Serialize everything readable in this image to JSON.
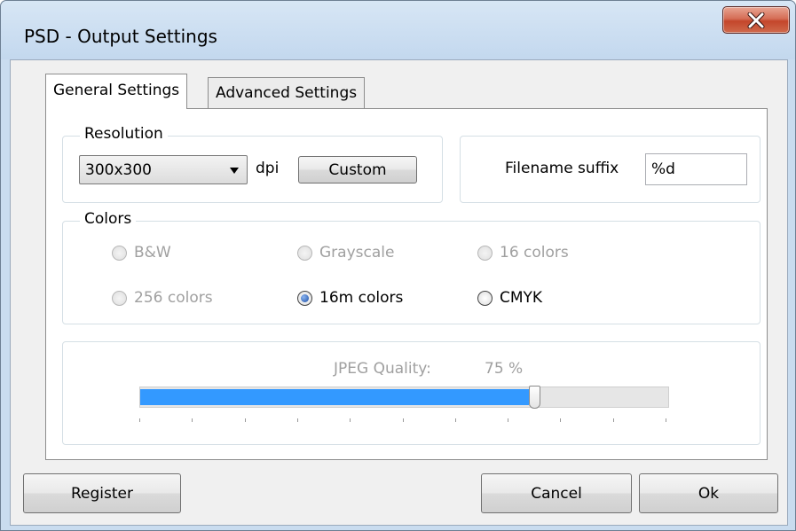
{
  "window": {
    "title": "PSD - Output Settings"
  },
  "tabs": [
    {
      "label": "General Settings",
      "active": true
    },
    {
      "label": "Advanced Settings",
      "active": false
    }
  ],
  "resolution": {
    "group_label": "Resolution",
    "selected": "300x300",
    "unit": "dpi",
    "custom_label": "Custom"
  },
  "filename": {
    "label": "Filename suffix",
    "value": "%d"
  },
  "colors": {
    "group_label": "Colors",
    "options": [
      {
        "label": "B&W",
        "enabled": false,
        "checked": false
      },
      {
        "label": "Grayscale",
        "enabled": false,
        "checked": false
      },
      {
        "label": "16 colors",
        "enabled": false,
        "checked": false
      },
      {
        "label": "256 colors",
        "enabled": false,
        "checked": false
      },
      {
        "label": "16m colors",
        "enabled": true,
        "checked": true
      },
      {
        "label": "CMYK",
        "enabled": true,
        "checked": false
      }
    ]
  },
  "jpeg": {
    "label": "JPEG Quality:",
    "value_text": "75 %",
    "value": 75,
    "max": 100
  },
  "buttons": {
    "register": "Register",
    "cancel": "Cancel",
    "ok": "Ok"
  },
  "colors_palette": {
    "accent": "#3399ff",
    "close": "#c4462b",
    "frame": "#c9dcef"
  },
  "icons": {
    "close": "close-icon",
    "dropdown": "chevron-down-icon"
  }
}
